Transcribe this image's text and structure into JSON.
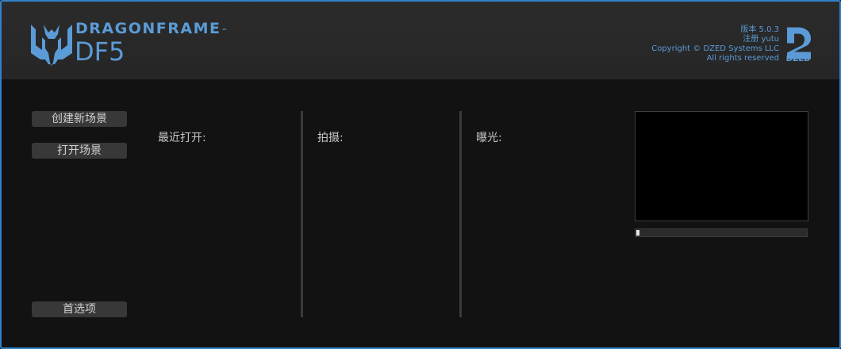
{
  "brand": {
    "name": "DRAGONFRAME",
    "trademark": "™",
    "version_mark": "DF5",
    "color": "#5b9bd7"
  },
  "about": {
    "version": "版本 5.0.3",
    "registration": "注册 yutu",
    "copyright": "Copyright © DZED Systems LLC",
    "rights": "All rights reserved",
    "company_logo_text": "DZED"
  },
  "actions": {
    "create_scene": "创建新场景",
    "open_scene": "打开场景",
    "preferences": "首选项"
  },
  "columns": {
    "recent": "最近打开:",
    "shoot": "拍摄:",
    "exposure": "曝光:"
  },
  "progress": {
    "fraction": 0.02
  },
  "icons": [
    "dragon-logo-icon",
    "dzed-logo-icon"
  ],
  "accent_color": "#2f82c8"
}
